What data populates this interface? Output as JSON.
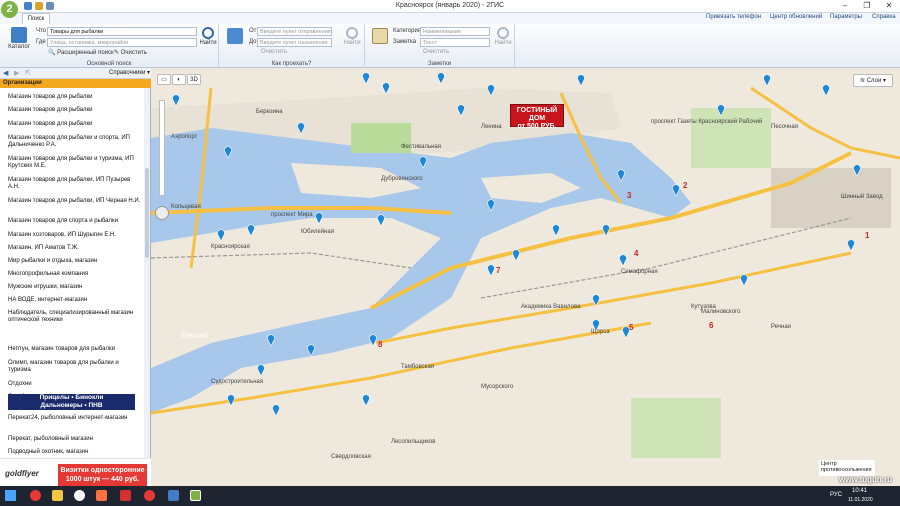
{
  "window": {
    "title": "Красноярск (январь 2020) - 2ГИС"
  },
  "menu": {
    "tab": "Поиск",
    "links": [
      "Привязать телефон",
      "Центр обновлений",
      "Параметры",
      "Справка"
    ]
  },
  "search_group": {
    "catalog_label": "Каталог",
    "what_label": "Что",
    "what_value": "Товары для рыбалки",
    "where_label": "Где",
    "where_placeholder": "Улица, остановка, микрорайон",
    "find_label": "Найти",
    "advanced_label": "Расширенный поиск",
    "clear_label": "Очистить",
    "group_label": "Основной поиск"
  },
  "route_group": {
    "from_label": "От",
    "from_placeholder": "Введите пункт отправления",
    "to_label": "До",
    "to_placeholder": "Введите пункт назначения",
    "clear_label": "Очистить",
    "find_label": "Найти",
    "group_label": "Как проехать?"
  },
  "notes_group": {
    "category_label": "Категория",
    "category_placeholder": "Наименование",
    "note_label": "Заметка",
    "note_placeholder": "Текст",
    "clear_label": "Очистить",
    "find_label": "Найти",
    "group_label": "Заметки"
  },
  "panel": {
    "reference_label": "Справочники",
    "header": "Организации",
    "items": [
      "Магазин товаров для рыбалки",
      "Магазин товаров для рыбалки",
      "Магазин товаров для рыбалки",
      "Магазин товаров для рыбалки и спорта, ИП Дальниченко Р.А.",
      "Магазин товаров для рыбалки и туризма, ИП Крутских М.Е.",
      "Магазин товаров для рыбалки, ИП Пузырев А.Н.",
      "Магазин товаров для рыбалки, ИП Черная Н.И.",
      "Магазин товаров для спорта и рыбалки",
      "Магазин хозтоваров, ИП Шурыгин Е.Н.",
      "Магазин, ИП Аматов Т.Ж.",
      "Мир рыбалки и отдыха, магазин",
      "Многопрофильная компания",
      "Мужские игрушки, магазин",
      "НА ВОДЕ, интернет-магазин",
      "Наблюдатель, специализированный магазин оптической техники",
      "Нептун, магазин товаров для рыбалки",
      "Олимп, магазин товаров для рыбалки и туризма",
      "Отдохни",
      "ОхотАктив, магазин товаров для охоты, рыбалки и туризма",
      "Перекат24, рыболовный интернет-магазин",
      "Перекат, рыболовный магазин",
      "Подводный охотник, магазин"
    ],
    "item_ad": [
      "Прицелы • Бинокли",
      "Дальномеры • ПНВ"
    ],
    "footer_logo": "goldflyer",
    "footer_ad": [
      "Визитки односторонние",
      "1000 штук — 440 руб."
    ]
  },
  "map": {
    "buttons": [
      "3D"
    ],
    "layers_label": "Слои",
    "ad": [
      "ГОСТИНЫЙ ДОМ",
      "от 500 РУБ."
    ],
    "numbers": [
      "1",
      "2",
      "3",
      "4",
      "5",
      "6",
      "7",
      "8"
    ],
    "streets": [
      "проспект Мира",
      "Дубровинского",
      "проспект Газеты Красноярский Рабочий",
      "Енисей",
      "Академика Вавилова",
      "Семафорная",
      "Песочная",
      "Мусорского",
      "Кольцевая",
      "Юбилейная",
      "Красноярская",
      "Малиновского",
      "Тамбовская",
      "Щорса",
      "Лесопильщиков",
      "Судостроительная",
      "Фестивальная",
      "Березина",
      "Кутузова",
      "Шинный Завод",
      "Речная",
      "Ленина",
      "Свердловская",
      "Аэропорт"
    ],
    "center_logo": [
      "Центр",
      "противоскольжения"
    ],
    "watermark": "www.tugun.ru"
  },
  "taskbar": {
    "lang": "РУС",
    "time": "10:41",
    "date": "11.01.2020"
  },
  "colors": {
    "accent": "#f4a81d",
    "water": "#a7c8ea",
    "land": "#efe9dd",
    "road": "#f6c042",
    "pin": "#1e88d6"
  }
}
